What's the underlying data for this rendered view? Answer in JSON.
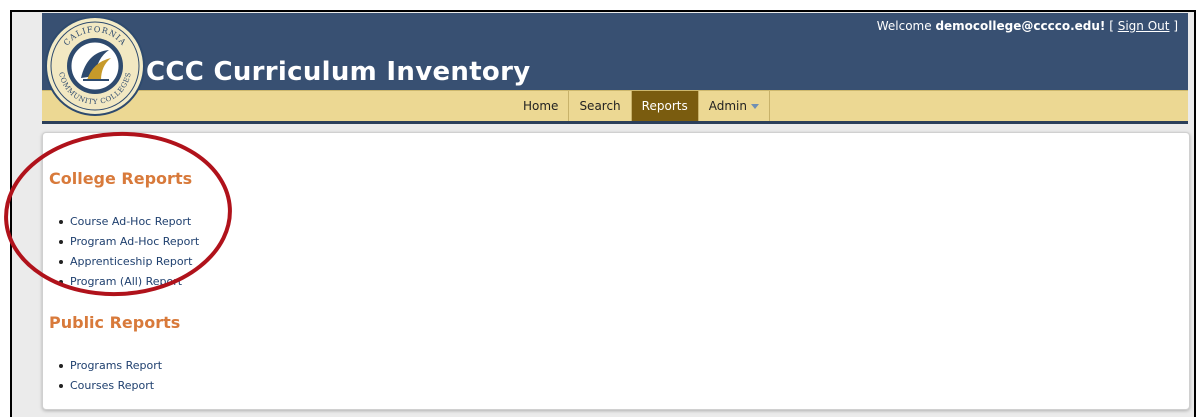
{
  "header": {
    "title": "CCC Curriculum Inventory",
    "welcome_prefix": "Welcome",
    "user": "democollege@cccco.edu!",
    "sign_out_open": "[",
    "sign_out": "Sign Out",
    "sign_out_close": "]",
    "logo_text_top": "CALIFORNIA",
    "logo_text_bottom": "COMMUNITY COLLEGES"
  },
  "nav": {
    "items": [
      {
        "label": "Home"
      },
      {
        "label": "Search"
      },
      {
        "label": "Reports"
      },
      {
        "label": "Admin"
      }
    ],
    "active": "Reports"
  },
  "main": {
    "college_reports_title": "College Reports",
    "college_reports": [
      "Course Ad-Hoc Report",
      "Program Ad-Hoc Report",
      "Apprenticeship Report",
      "Program (All) Report"
    ],
    "public_reports_title": "Public Reports",
    "public_reports": [
      "Programs Report",
      "Courses Report"
    ]
  },
  "colors": {
    "header_blue": "#385072",
    "nav_gold": "#ecd893",
    "active_tab": "#7a5c0f",
    "section_title": "#d87a3b",
    "annotation": "#b0121b"
  },
  "icons": {
    "logo": "california-community-colleges-seal",
    "admin_dropdown": "chevron-down-icon"
  }
}
